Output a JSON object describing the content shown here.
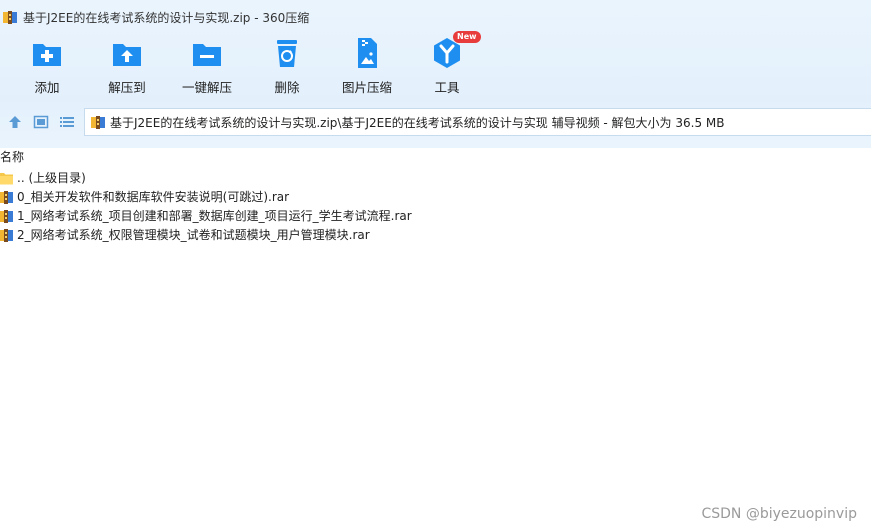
{
  "window": {
    "title": "基于J2EE的在线考试系统的设计与实现.zip - 360压缩"
  },
  "toolbar": {
    "buttons": [
      {
        "label": "添加",
        "icon": "add-file-icon"
      },
      {
        "label": "解压到",
        "icon": "extract-to-icon"
      },
      {
        "label": "一键解压",
        "icon": "one-click-extract-icon"
      },
      {
        "label": "删除",
        "icon": "recycle-delete-icon"
      },
      {
        "label": "图片压缩",
        "icon": "image-compress-icon"
      },
      {
        "label": "工具",
        "icon": "tools-icon",
        "badge": "New"
      }
    ]
  },
  "nav": {
    "path": "基于J2EE的在线考试系统的设计与实现.zip\\基于J2EE的在线考试系统的设计与实现 辅导视频 - 解包大小为 36.5 MB"
  },
  "list": {
    "column_name": "名称",
    "items": [
      {
        "name": ".. (上级目录)",
        "type": "folder"
      },
      {
        "name": "0_相关开发软件和数据库软件安装说明(可跳过).rar",
        "type": "rar"
      },
      {
        "name": "1_网络考试系统_项目创建和部署_数据库创建_项目运行_学生考试流程.rar",
        "type": "rar"
      },
      {
        "name": "2_网络考试系统_权限管理模块_试卷和试题模块_用户管理模块.rar",
        "type": "rar"
      }
    ]
  },
  "watermark": "CSDN @biyezuopinvip",
  "colors": {
    "accent_blue": "#1e8ff0",
    "badge_red": "#e83b3b",
    "header_bg": "#e3f0fc"
  }
}
